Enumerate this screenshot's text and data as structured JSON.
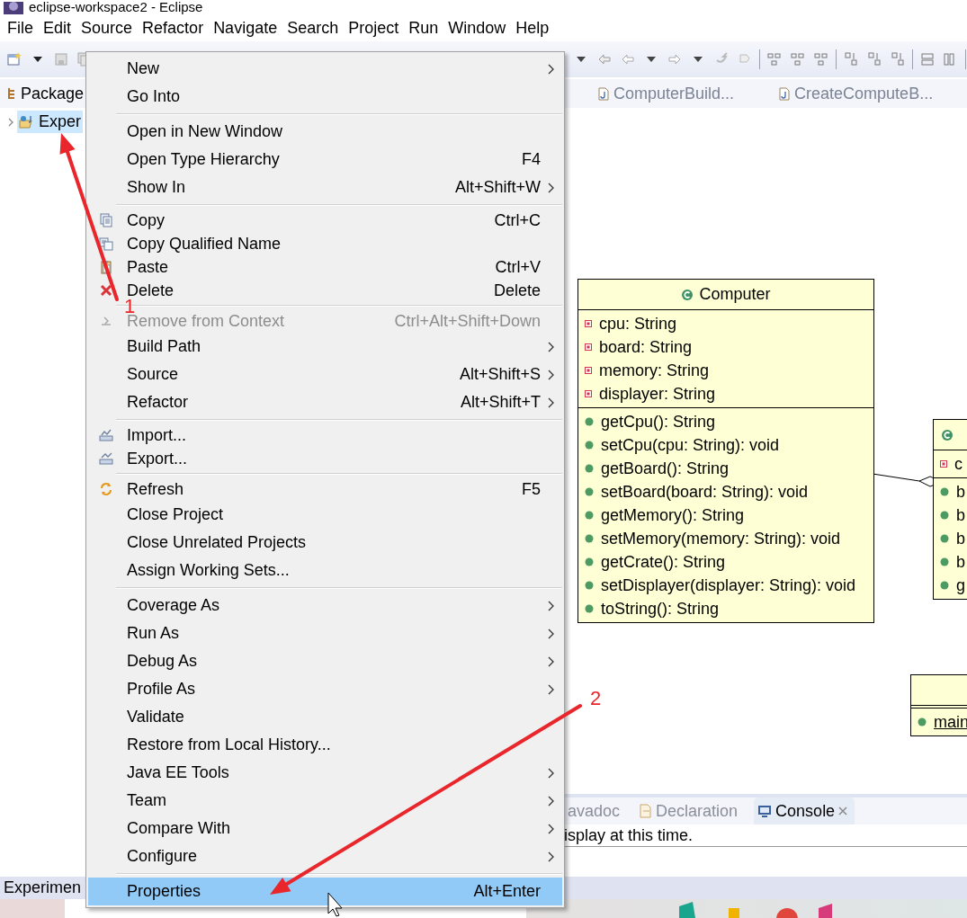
{
  "window": {
    "title": "eclipse-workspace2 - Eclipse"
  },
  "menu_bar": [
    "File",
    "Edit",
    "Source",
    "Refactor",
    "Navigate",
    "Search",
    "Project",
    "Run",
    "Window",
    "Help"
  ],
  "package_explorer": {
    "title": "Package",
    "tree": [
      {
        "label": "Exper",
        "selected": true,
        "expanded": false
      }
    ]
  },
  "editor_tabs": [
    {
      "label": "ComputerBuild..."
    },
    {
      "label": "CreateComputeB..."
    }
  ],
  "diagram": {
    "classes": [
      {
        "name": "Computer",
        "fields": [
          "cpu: String",
          "board: String",
          "memory: String",
          "displayer: String"
        ],
        "methods": [
          {
            "label": "getCpu(): String"
          },
          {
            "label": "setCpu(cpu: String): void"
          },
          {
            "label": "getBoard(): String"
          },
          {
            "label": "setBoard(board: String): void"
          },
          {
            "label": "getMemory(): String"
          },
          {
            "label": "setMemory(memory: String): void"
          },
          {
            "label": "getCrate(): String"
          },
          {
            "label": "setDisplayer(displayer: String): void"
          },
          {
            "label": "toString(): String"
          }
        ]
      },
      {
        "fields": [
          "c"
        ],
        "methods": [
          {
            "label": "b"
          },
          {
            "label": "b"
          },
          {
            "label": "b"
          },
          {
            "label": "b"
          },
          {
            "label": "g"
          }
        ]
      },
      {
        "methods": [
          {
            "label": "main",
            "static": true
          }
        ]
      }
    ]
  },
  "bottom_panel": {
    "tabs": [
      {
        "label": "avadoc",
        "selected": false
      },
      {
        "label": "Declaration",
        "selected": false
      },
      {
        "label": "Console",
        "selected": true
      }
    ],
    "console_text": "isplay at this time."
  },
  "status_bar": "Experimen",
  "context_menu": [
    {
      "kind": "item",
      "label": "New",
      "submenu": true,
      "disabled": false,
      "selected": false
    },
    {
      "kind": "item",
      "label": "Go Into",
      "disabled": false,
      "selected": false
    },
    {
      "kind": "separator"
    },
    {
      "kind": "item",
      "label": "Open in New Window",
      "disabled": false,
      "selected": false
    },
    {
      "kind": "item",
      "label": "Open Type Hierarchy",
      "shortcut": "F4",
      "disabled": false,
      "selected": false
    },
    {
      "kind": "item",
      "label": "Show In",
      "shortcut": "Alt+Shift+W",
      "submenu": true,
      "disabled": false,
      "selected": false
    },
    {
      "kind": "separator"
    },
    {
      "kind": "item",
      "label": "Copy",
      "shortcut": "Ctrl+C",
      "disabled": false,
      "selected": false
    },
    {
      "kind": "item",
      "label": "Copy Qualified Name",
      "disabled": false,
      "selected": false
    },
    {
      "kind": "item",
      "label": "Paste",
      "shortcut": "Ctrl+V",
      "disabled": false,
      "selected": false
    },
    {
      "kind": "item",
      "label": "Delete",
      "shortcut": "Delete",
      "disabled": false,
      "selected": false
    },
    {
      "kind": "separator"
    },
    {
      "kind": "item",
      "label": "Remove from Context",
      "shortcut": "Ctrl+Alt+Shift+Down",
      "disabled": true,
      "selected": false
    },
    {
      "kind": "item",
      "label": "Build Path",
      "submenu": true,
      "disabled": false,
      "selected": false
    },
    {
      "kind": "item",
      "label": "Source",
      "shortcut": "Alt+Shift+S",
      "submenu": true,
      "disabled": false,
      "selected": false
    },
    {
      "kind": "item",
      "label": "Refactor",
      "shortcut": "Alt+Shift+T",
      "submenu": true,
      "disabled": false,
      "selected": false
    },
    {
      "kind": "separator"
    },
    {
      "kind": "item",
      "label": "Import...",
      "disabled": false,
      "selected": false
    },
    {
      "kind": "item",
      "label": "Export...",
      "disabled": false,
      "selected": false
    },
    {
      "kind": "separator"
    },
    {
      "kind": "item",
      "label": "Refresh",
      "shortcut": "F5",
      "disabled": false,
      "selected": false
    },
    {
      "kind": "item",
      "label": "Close Project",
      "disabled": false,
      "selected": false
    },
    {
      "kind": "item",
      "label": "Close Unrelated Projects",
      "disabled": false,
      "selected": false
    },
    {
      "kind": "item",
      "label": "Assign Working Sets...",
      "disabled": false,
      "selected": false
    },
    {
      "kind": "separator"
    },
    {
      "kind": "item",
      "label": "Coverage As",
      "submenu": true,
      "disabled": false,
      "selected": false
    },
    {
      "kind": "item",
      "label": "Run As",
      "submenu": true,
      "disabled": false,
      "selected": false
    },
    {
      "kind": "item",
      "label": "Debug As",
      "submenu": true,
      "disabled": false,
      "selected": false
    },
    {
      "kind": "item",
      "label": "Profile As",
      "submenu": true,
      "disabled": false,
      "selected": false
    },
    {
      "kind": "item",
      "label": "Validate",
      "disabled": false,
      "selected": false
    },
    {
      "kind": "item",
      "label": "Restore from Local History...",
      "disabled": false,
      "selected": false
    },
    {
      "kind": "item",
      "label": "Java EE Tools",
      "submenu": true,
      "disabled": false,
      "selected": false
    },
    {
      "kind": "item",
      "label": "Team",
      "submenu": true,
      "disabled": false,
      "selected": false
    },
    {
      "kind": "item",
      "label": "Compare With",
      "submenu": true,
      "disabled": false,
      "selected": false
    },
    {
      "kind": "item",
      "label": "Configure",
      "submenu": true,
      "disabled": false,
      "selected": false
    },
    {
      "kind": "separator"
    },
    {
      "kind": "item",
      "label": "Properties",
      "shortcut": "Alt+Enter",
      "disabled": false,
      "selected": true
    }
  ],
  "annotations": [
    {
      "label": "1"
    },
    {
      "label": "2"
    }
  ]
}
